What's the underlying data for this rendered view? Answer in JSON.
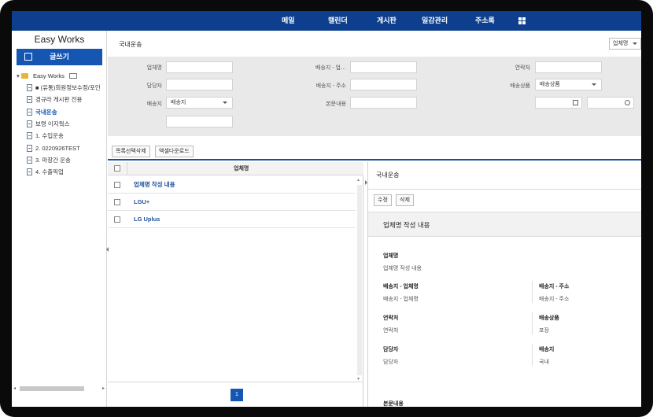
{
  "nav": {
    "items": [
      "메일",
      "캘린더",
      "게시판",
      "일감관리",
      "주소록"
    ]
  },
  "sidebar": {
    "brand": "Easy Works",
    "write_label": "글쓰기",
    "root_label": "Easy Works",
    "items": [
      {
        "label": "■ (유통)회원정보수정/포인"
      },
      {
        "label": "경규라 게시판 전용"
      },
      {
        "label": "국내운송"
      },
      {
        "label": "보령 이지웍스"
      },
      {
        "label": "1. 수입운송"
      },
      {
        "label": "2. 0220926TEST"
      },
      {
        "label": "3. 마장간 운송"
      },
      {
        "label": "4. 수출픽업"
      }
    ],
    "active_index": 2
  },
  "main": {
    "title": "국내운송",
    "company_select": "업체명",
    "filters": {
      "company_label": "업체명",
      "manager_label": "담당자",
      "delivery_label": "배송지",
      "delivery_value": "배송지",
      "delivery_company_label": "배송지 - 업…",
      "delivery_address_label": "배송지 - 주소",
      "body_label": "본문내용",
      "contact_label": "연락처",
      "product_label": "배송상품",
      "product_value": "배송상품"
    },
    "buttons": {
      "delete_selected": "목록선택삭제",
      "excel_download": "엑셀다운로드"
    },
    "list": {
      "header": "업체명",
      "rows": [
        "업체명 작성 내용",
        "LGU+",
        "LG Uplus"
      ],
      "page": "1"
    },
    "detail": {
      "title": "국내운송",
      "edit_label": "수정",
      "delete_label": "삭제",
      "panel_title": "업체명 작성 내용",
      "fields": {
        "company_label": "업체명",
        "company_value": "업체명 작성 내용",
        "delivery_company_label": "배송지 - 업체명",
        "delivery_company_value": "배송지 - 업체명",
        "delivery_address_label": "배송지 - 주소",
        "delivery_address_value": "배송지 - 주소",
        "contact_label": "연락처",
        "contact_value": "연락처",
        "product_label": "배송상품",
        "product_value": "포장",
        "manager_label": "담당자",
        "manager_value": "담당자",
        "delivery_label": "배송지",
        "delivery_value": "국내",
        "body_label": "본문내용"
      }
    }
  },
  "colors": {
    "accent": "#0e3f8e",
    "primary_button": "#1556b3",
    "filter_bg": "#e9e9e9"
  }
}
